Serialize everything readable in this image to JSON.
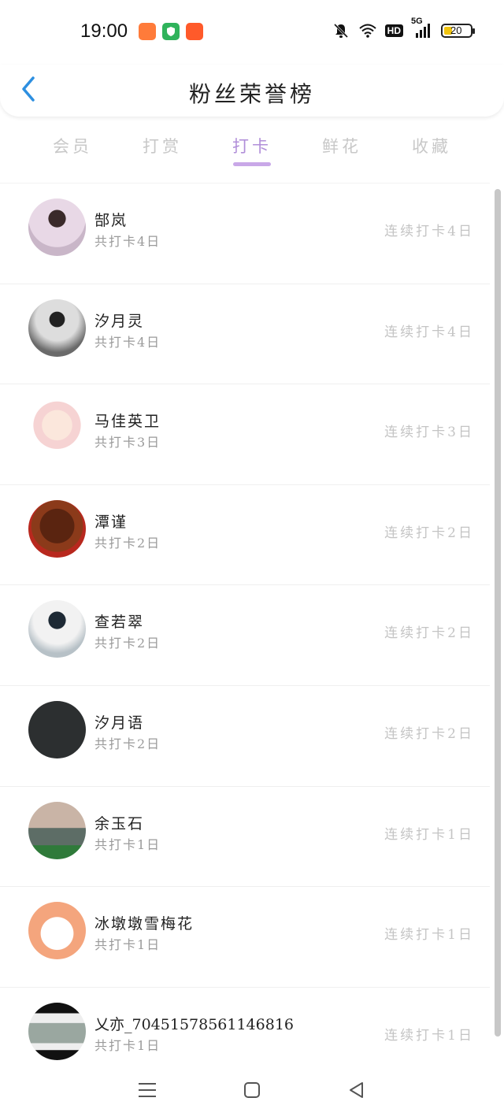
{
  "status_bar": {
    "time": "19:00",
    "hd": "HD",
    "net": "5G",
    "battery": "20"
  },
  "header": {
    "title": "粉丝荣誉榜"
  },
  "tabs": [
    {
      "label": "会员",
      "active": false
    },
    {
      "label": "打赏",
      "active": false
    },
    {
      "label": "打卡",
      "active": true
    },
    {
      "label": "鲜花",
      "active": false
    },
    {
      "label": "收藏",
      "active": false
    }
  ],
  "list": [
    {
      "name": "郜岚",
      "total": "共打卡4日",
      "streak": "连续打卡4日",
      "avatar_color": "#c9b6c8"
    },
    {
      "name": "汐月灵",
      "total": "共打卡4日",
      "streak": "连续打卡4日",
      "avatar_color": "#8a8a8a"
    },
    {
      "name": "马佳英卫",
      "total": "共打卡3日",
      "streak": "连续打卡3日",
      "avatar_color": "#f3dede"
    },
    {
      "name": "潭谨",
      "total": "共打卡2日",
      "streak": "连续打卡2日",
      "avatar_color": "#7a2a12"
    },
    {
      "name": "查若翠",
      "total": "共打卡2日",
      "streak": "连续打卡2日",
      "avatar_color": "#b7c1c7"
    },
    {
      "name": "汐月语",
      "total": "共打卡2日",
      "streak": "连续打卡2日",
      "avatar_color": "#2c2f30"
    },
    {
      "name": "余玉石",
      "total": "共打卡1日",
      "streak": "连续打卡1日",
      "avatar_color": "#6f7a74"
    },
    {
      "name": "冰墩墩雪梅花",
      "total": "共打卡1日",
      "streak": "连续打卡1日",
      "avatar_color": "#f08a5a"
    },
    {
      "name": "乂亦_70451578561146816",
      "total": "共打卡1日",
      "streak": "连续打卡1日",
      "avatar_color": "#9aa7a0"
    }
  ]
}
